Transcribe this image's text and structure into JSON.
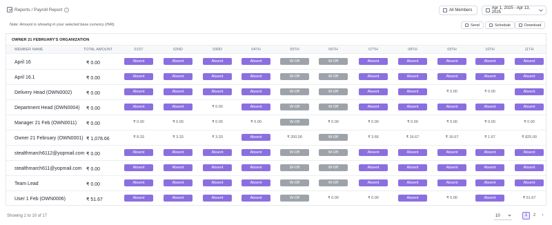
{
  "breadcrumb": {
    "text": "Reports / Payroll Report",
    "info": "i"
  },
  "filters": {
    "members": "All Members",
    "daterange": "Apr 1, 2025 - Apr 13, 2025"
  },
  "note": "Note: Amount is showing in your selected base currency (INR).",
  "actions": {
    "send": "Send",
    "schedule": "Schedule",
    "download": "Download"
  },
  "org": "OWNER 21 FEBRUARY'S ORGANIZATION",
  "columns": {
    "name": "MEMBER NAME",
    "total": "TOTAL AMOUNT",
    "days": [
      "01ST",
      "02ND",
      "03RD",
      "04TH",
      "05TH",
      "06TH",
      "07TH",
      "08TH",
      "09TH",
      "10TH",
      "11TH"
    ]
  },
  "rows": [
    {
      "name": "April 16",
      "total": "₹ 0.00",
      "days": [
        "Absent",
        "Absent",
        "Absent",
        "Absent",
        "W-Off",
        "W-Off",
        "Absent",
        "Absent",
        "Absent",
        "Absent",
        "Absent"
      ]
    },
    {
      "name": "April 16.1",
      "total": "₹ 0.00",
      "days": [
        "Absent",
        "Absent",
        "Absent",
        "Absent",
        "W-Off",
        "W-Off",
        "Absent",
        "Absent",
        "Absent",
        "Absent",
        "Absent"
      ]
    },
    {
      "name": "Delivery Head (OWN0002)",
      "total": "₹ 0.00",
      "days": [
        "Absent",
        "Absent",
        "Absent",
        "Absent",
        "W-Off",
        "W-Off",
        "Absent",
        "Absent",
        "₹ 0.00",
        "₹ 0.00",
        "Absent"
      ]
    },
    {
      "name": "Department Head (OWN0004)",
      "total": "₹ 0.00",
      "days": [
        "Absent",
        "Absent",
        "₹ 0.00",
        "Absent",
        "W-Off",
        "W-Off",
        "Absent",
        "Absent",
        "Absent",
        "Absent",
        "Absent"
      ]
    },
    {
      "name": "Manager 21 Feb (OWN0011)",
      "total": "₹ 0.00",
      "days": [
        "₹ 0.00",
        "₹ 0.00",
        "₹ 0.00",
        "₹ 0.00",
        "W-Off",
        "₹ 0.00",
        "₹ 0.00",
        "₹ 0.00",
        "₹ 0.00",
        "₹ 0.00",
        "₹ 0.00"
      ]
    },
    {
      "name": "Owner 21 February (OWN0001)",
      "total": "₹ 1,078.66",
      "days": [
        "₹ 8.33",
        "₹ 3.33",
        "₹ 3.33",
        "Absent",
        "₹ 200.00",
        "W-Off",
        "₹ 3.66",
        "₹ 16.67",
        "₹ 16.67",
        "₹ 1.67",
        "₹ 825.00"
      ]
    },
    {
      "name": "stealthmarch6112@yopmail.com",
      "total": "₹ 0.00",
      "days": [
        "Absent",
        "Absent",
        "Absent",
        "Absent",
        "W-Off",
        "W-Off",
        "Absent",
        "Absent",
        "Absent",
        "Absent",
        "Absent"
      ]
    },
    {
      "name": "stealthmarch611@yopmail.com",
      "total": "₹ 0.00",
      "days": [
        "Absent",
        "Absent",
        "Absent",
        "Absent",
        "W-Off",
        "W-Off",
        "Absent",
        "Absent",
        "Absent",
        "Absent",
        "Absent"
      ]
    },
    {
      "name": "Team Lead",
      "total": "₹ 0.00",
      "days": [
        "Absent",
        "Absent",
        "Absent",
        "Absent",
        "W-Off",
        "W-Off",
        "Absent",
        "Absent",
        "Absent",
        "Absent",
        "Absent"
      ]
    },
    {
      "name": "User 1 Feb (OWN0006)",
      "total": "₹ 51.67",
      "days": [
        "Absent",
        "Absent",
        "Absent",
        "Absent",
        "W-Off",
        "₹ 0.00",
        "₹ 0.00",
        "Absent",
        "₹ 0.00",
        "Absent",
        "₹ 51.67"
      ]
    }
  ],
  "footer": {
    "showing": "Showing 1 to 10 of 17",
    "page_size": "10",
    "pages": [
      "1",
      "2"
    ],
    "next": "›"
  },
  "colors": {
    "absent": "#8b6fe0",
    "woff": "#9ea3ab",
    "accent": "#8b6fe0"
  }
}
